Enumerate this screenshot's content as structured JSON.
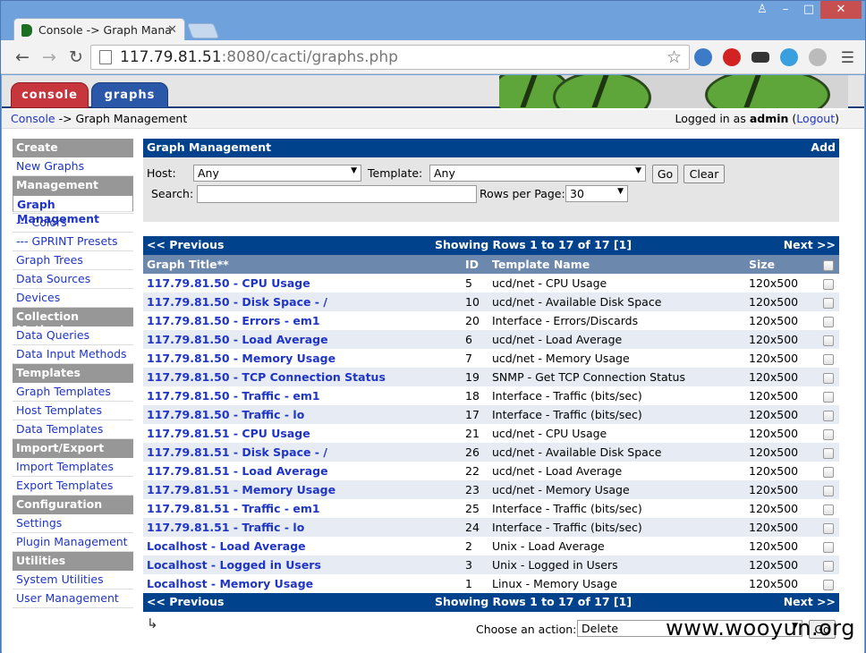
{
  "browser": {
    "tab_title": "Console -> Graph Mana",
    "url_host": "117.79.81.51",
    "url_rest": ":8080/cacti/graphs.php"
  },
  "header": {
    "console_tab": "console",
    "graphs_tab": "graphs",
    "breadcrumb": "Console -> Graph Management",
    "login_prefix": "Logged in as",
    "user": "admin",
    "logout": "Logout"
  },
  "sidebar": [
    {
      "type": "h",
      "label": "Create"
    },
    {
      "type": "i",
      "label": "New Graphs"
    },
    {
      "type": "h",
      "label": "Management"
    },
    {
      "type": "i",
      "label": "Graph Management",
      "selected": true
    },
    {
      "type": "i",
      "label": "--- CDEFs"
    },
    {
      "type": "i",
      "label": "--- Colors"
    },
    {
      "type": "i",
      "label": "--- GPRINT Presets"
    },
    {
      "type": "i",
      "label": "Graph Trees"
    },
    {
      "type": "i",
      "label": "Data Sources"
    },
    {
      "type": "i",
      "label": "Devices"
    },
    {
      "type": "h",
      "label": "Collection Methods"
    },
    {
      "type": "i",
      "label": "Data Queries"
    },
    {
      "type": "i",
      "label": "Data Input Methods"
    },
    {
      "type": "h",
      "label": "Templates"
    },
    {
      "type": "i",
      "label": "Graph Templates"
    },
    {
      "type": "i",
      "label": "Host Templates"
    },
    {
      "type": "i",
      "label": "Data Templates"
    },
    {
      "type": "h",
      "label": "Import/Export"
    },
    {
      "type": "i",
      "label": "Import Templates"
    },
    {
      "type": "i",
      "label": "Export Templates"
    },
    {
      "type": "h",
      "label": "Configuration"
    },
    {
      "type": "i",
      "label": "Settings"
    },
    {
      "type": "i",
      "label": "Plugin Management"
    },
    {
      "type": "h",
      "label": "Utilities"
    },
    {
      "type": "i",
      "label": "System Utilities"
    },
    {
      "type": "i",
      "label": "User Management"
    }
  ],
  "panel": {
    "title": "Graph Management",
    "add": "Add",
    "host_label": "Host:",
    "host_value": "Any",
    "template_label": "Template:",
    "template_value": "Any",
    "go": "Go",
    "clear": "Clear",
    "search_label": "Search:",
    "search_value": "",
    "rows_label": "Rows per Page:",
    "rows_value": "30"
  },
  "nav": {
    "prev": "<< Previous",
    "showing": "Showing Rows 1 to 17 of 17 [",
    "page": "1",
    "close_bracket": "]",
    "next": "Next >>"
  },
  "columns": [
    "Graph Title**",
    "ID",
    "Template Name",
    "Size"
  ],
  "rows": [
    [
      "117.79.81.50 - CPU Usage",
      "5",
      "ucd/net - CPU Usage",
      "120x500"
    ],
    [
      "117.79.81.50 - Disk Space - /",
      "10",
      "ucd/net - Available Disk Space",
      "120x500"
    ],
    [
      "117.79.81.50 - Errors - em1",
      "20",
      "Interface - Errors/Discards",
      "120x500"
    ],
    [
      "117.79.81.50 - Load Average",
      "6",
      "ucd/net - Load Average",
      "120x500"
    ],
    [
      "117.79.81.50 - Memory Usage",
      "7",
      "ucd/net - Memory Usage",
      "120x500"
    ],
    [
      "117.79.81.50 - TCP Connection Status",
      "19",
      "SNMP - Get TCP Connection Status",
      "120x500"
    ],
    [
      "117.79.81.50 - Traffic - em1",
      "18",
      "Interface - Traffic (bits/sec)",
      "120x500"
    ],
    [
      "117.79.81.50 - Traffic - lo",
      "17",
      "Interface - Traffic (bits/sec)",
      "120x500"
    ],
    [
      "117.79.81.51 - CPU Usage",
      "21",
      "ucd/net - CPU Usage",
      "120x500"
    ],
    [
      "117.79.81.51 - Disk Space - /",
      "26",
      "ucd/net - Available Disk Space",
      "120x500"
    ],
    [
      "117.79.81.51 - Load Average",
      "22",
      "ucd/net - Load Average",
      "120x500"
    ],
    [
      "117.79.81.51 - Memory Usage",
      "23",
      "ucd/net - Memory Usage",
      "120x500"
    ],
    [
      "117.79.81.51 - Traffic - em1",
      "25",
      "Interface - Traffic (bits/sec)",
      "120x500"
    ],
    [
      "117.79.81.51 - Traffic - lo",
      "24",
      "Interface - Traffic (bits/sec)",
      "120x500"
    ],
    [
      "Localhost - Load Average",
      "2",
      "Unix - Load Average",
      "120x500"
    ],
    [
      "Localhost - Logged in Users",
      "3",
      "Unix - Logged in Users",
      "120x500"
    ],
    [
      "Localhost - Memory Usage",
      "1",
      "Linux - Memory Usage",
      "120x500"
    ]
  ],
  "action": {
    "label": "Choose an action:",
    "value": "Delete",
    "go": "Go"
  },
  "watermark": "www.wooyun.org"
}
